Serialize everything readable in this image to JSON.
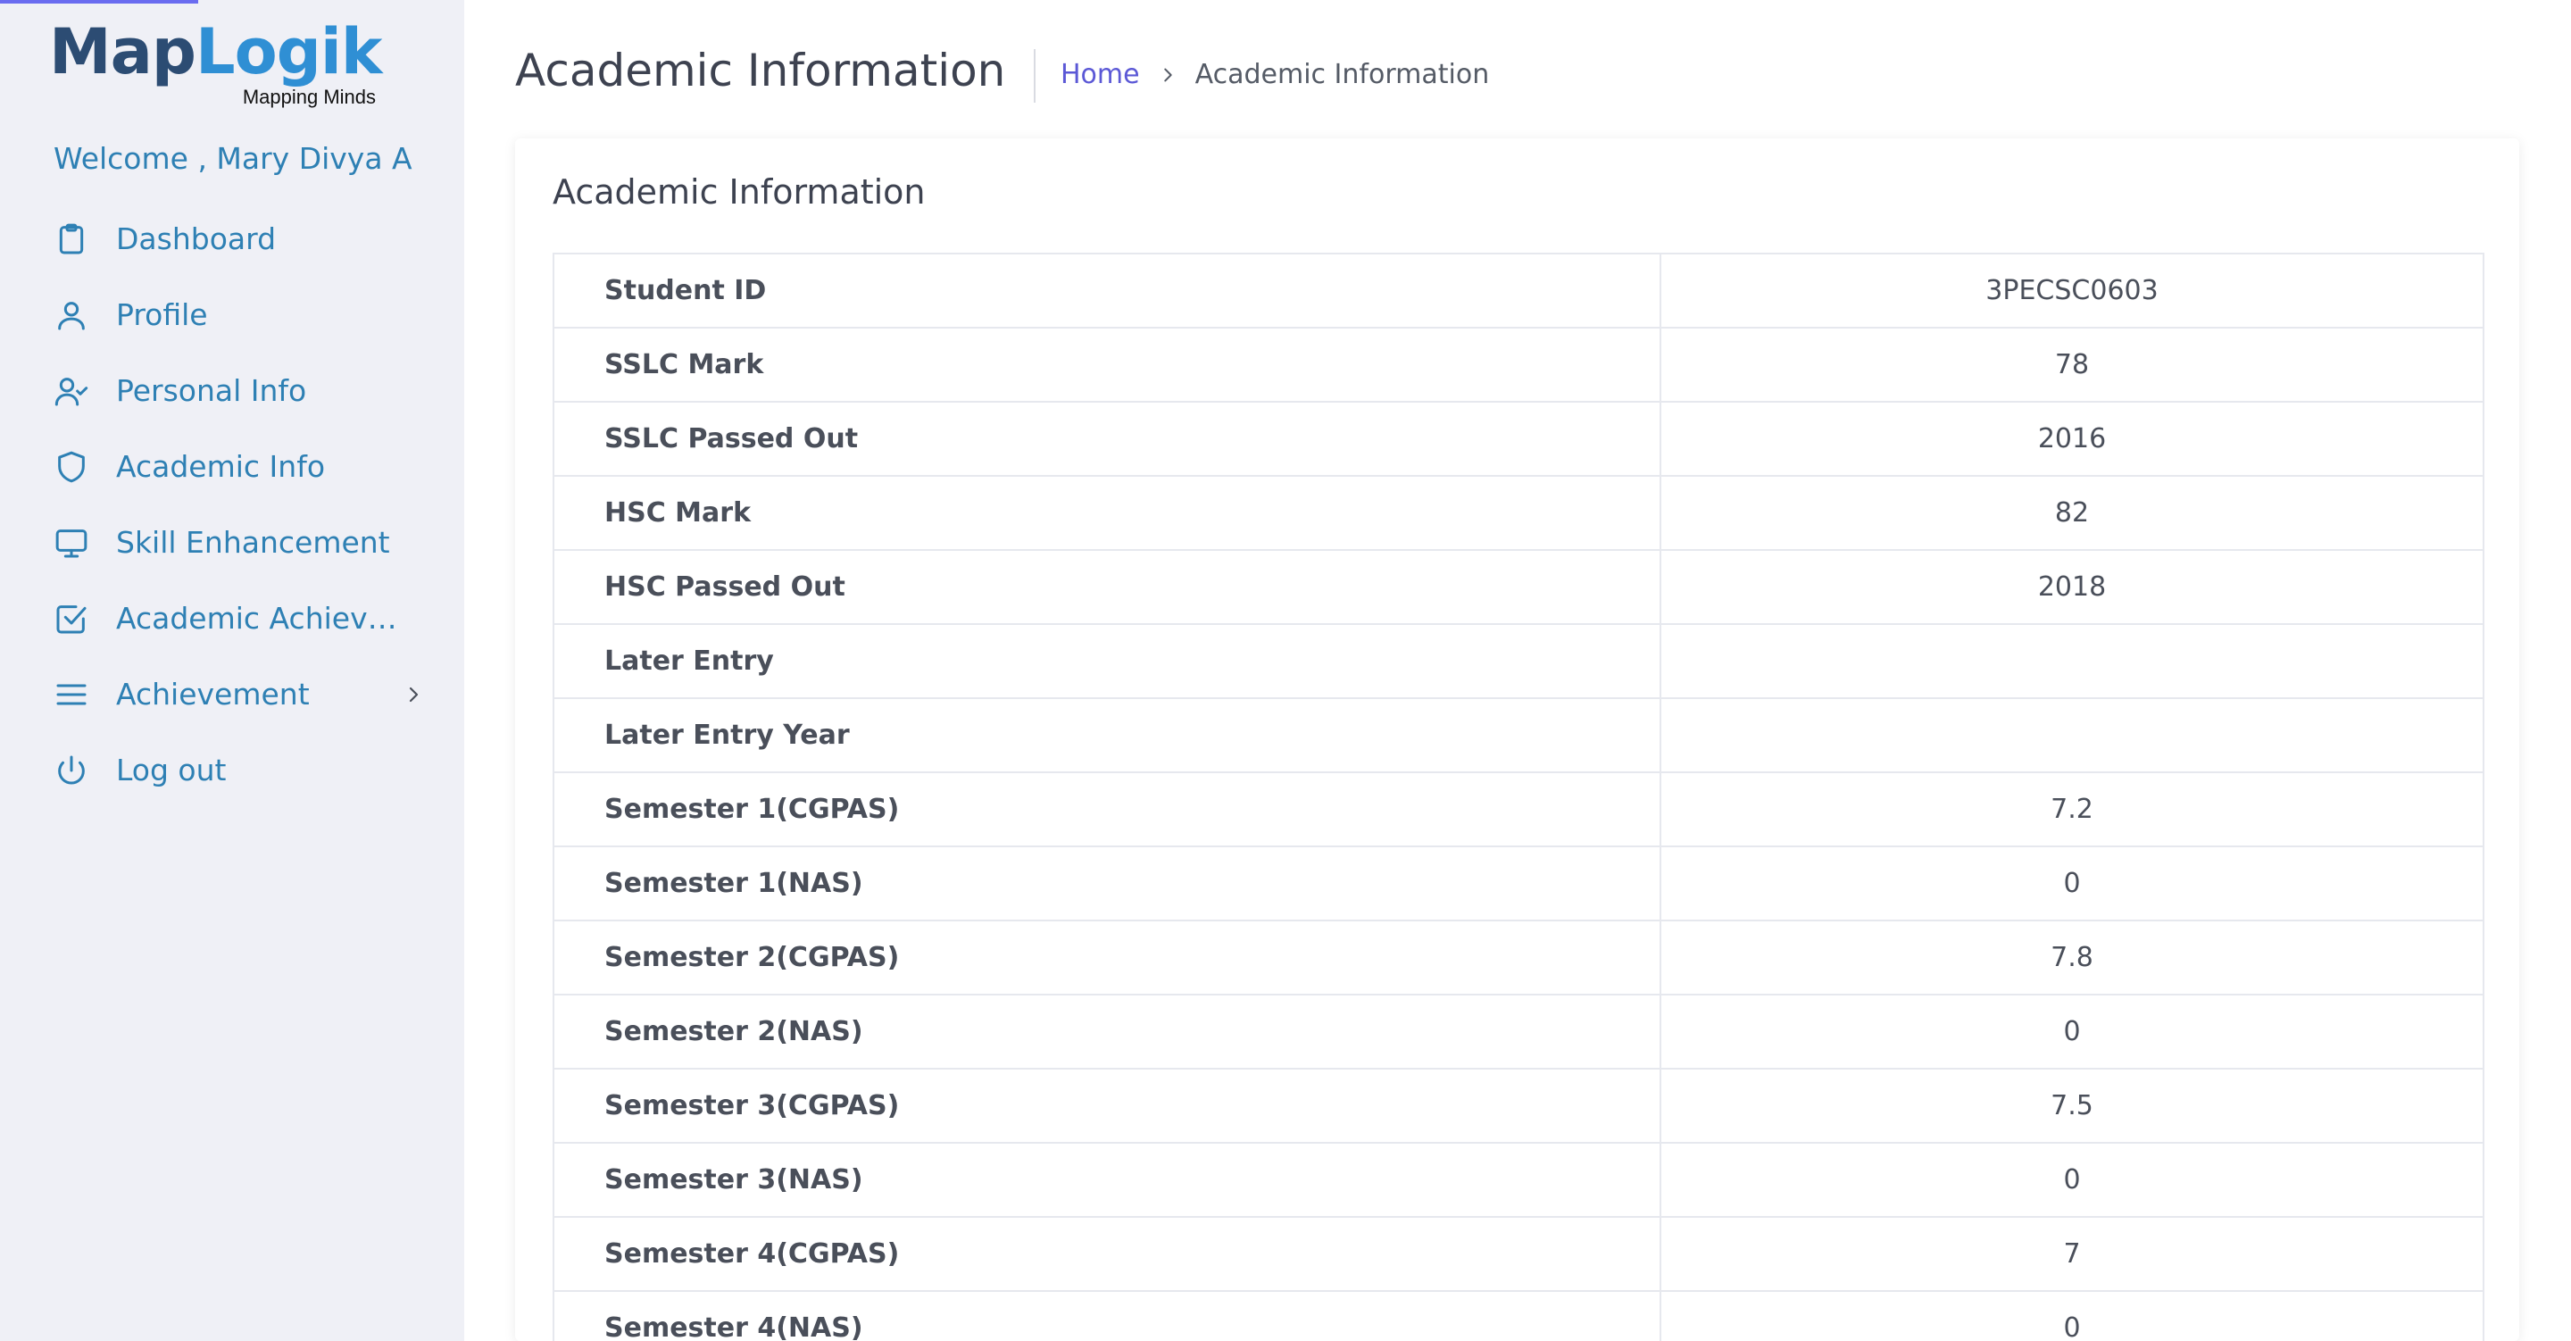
{
  "brand": {
    "logo_part1": "Map",
    "logo_part2": "Logik",
    "tagline": "Mapping Minds",
    "colors": {
      "dark": "#2c4c73",
      "light": "#2f8fd4"
    }
  },
  "sidebar": {
    "welcome": "Welcome , Mary Divya A",
    "items": [
      {
        "label": "Dashboard",
        "icon": "clipboard-icon"
      },
      {
        "label": "Profile",
        "icon": "user-icon"
      },
      {
        "label": "Personal Info",
        "icon": "user-check-icon"
      },
      {
        "label": "Academic Info",
        "icon": "shield-icon"
      },
      {
        "label": "Skill Enhancement",
        "icon": "monitor-icon"
      },
      {
        "label": "Academic Achievements",
        "icon": "check-square-icon"
      },
      {
        "label": "Achievement",
        "icon": "menu-icon"
      },
      {
        "label": "Log out",
        "icon": "power-icon"
      }
    ]
  },
  "header": {
    "title": "Academic Information",
    "breadcrumb": {
      "home": "Home",
      "current": "Academic Information"
    }
  },
  "card": {
    "title": "Academic Information",
    "rows": [
      {
        "key": "Student ID",
        "value": "3PECSC0603"
      },
      {
        "key": "SSLC Mark",
        "value": "78"
      },
      {
        "key": "SSLC Passed Out",
        "value": "2016"
      },
      {
        "key": "HSC Mark",
        "value": "82"
      },
      {
        "key": "HSC Passed Out",
        "value": "2018"
      },
      {
        "key": "Later Entry",
        "value": ""
      },
      {
        "key": "Later Entry Year",
        "value": ""
      },
      {
        "key": "Semester 1(CGPAS)",
        "value": "7.2"
      },
      {
        "key": "Semester 1(NAS)",
        "value": "0"
      },
      {
        "key": "Semester 2(CGPAS)",
        "value": "7.8"
      },
      {
        "key": "Semester 2(NAS)",
        "value": "0"
      },
      {
        "key": "Semester 3(CGPAS)",
        "value": "7.5"
      },
      {
        "key": "Semester 3(NAS)",
        "value": "0"
      },
      {
        "key": "Semester 4(CGPAS)",
        "value": "7"
      },
      {
        "key": "Semester 4(NAS)",
        "value": "0"
      }
    ]
  }
}
